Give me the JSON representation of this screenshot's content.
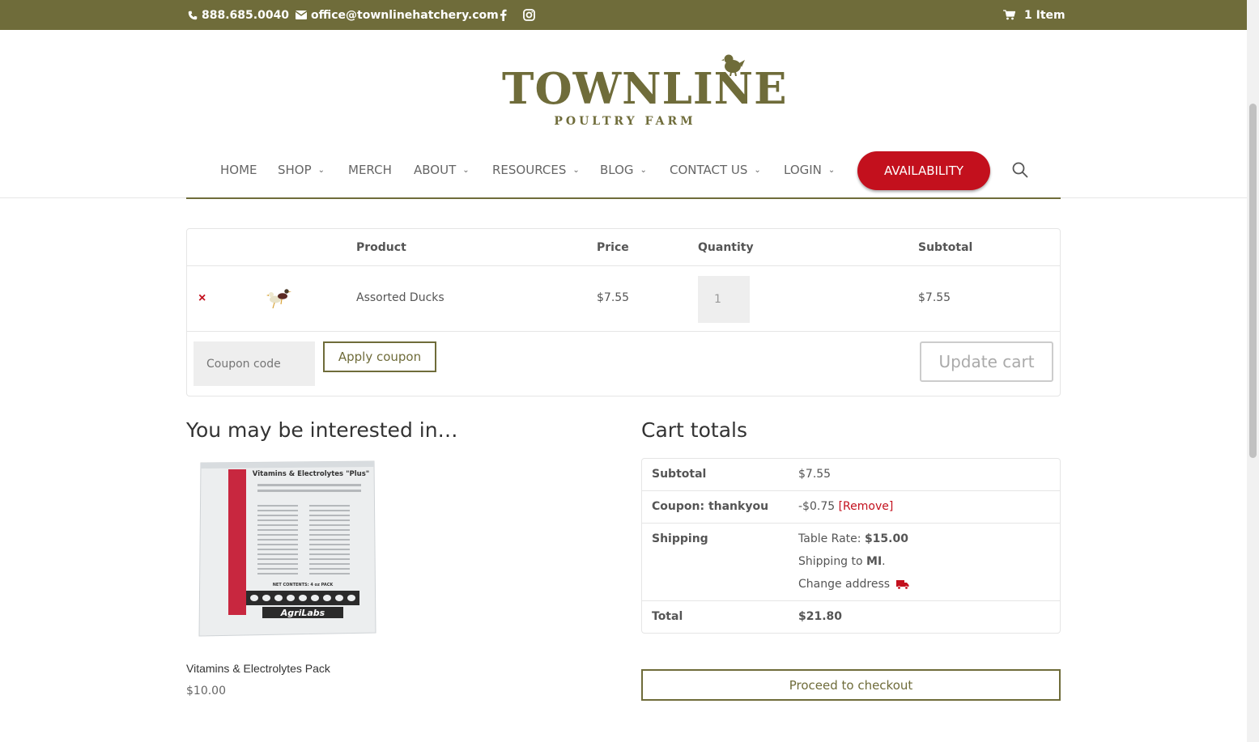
{
  "topbar": {
    "phone": "888.685.0040",
    "email": "office@townlinehatchery.com",
    "cart_count": "1 Item",
    "icons": [
      "phone-icon",
      "mail-icon",
      "facebook-icon",
      "instagram-icon",
      "cart-icon"
    ]
  },
  "logo": {
    "main": "TOWNLINE",
    "sub": "POULTRY FARM"
  },
  "nav": {
    "items": [
      {
        "label": "HOME",
        "has_dropdown": false
      },
      {
        "label": "SHOP",
        "has_dropdown": true
      },
      {
        "label": "MERCH",
        "has_dropdown": false
      },
      {
        "label": "ABOUT",
        "has_dropdown": true
      },
      {
        "label": "RESOURCES",
        "has_dropdown": true
      },
      {
        "label": "BLOG",
        "has_dropdown": true
      },
      {
        "label": "CONTACT US",
        "has_dropdown": true
      },
      {
        "label": "LOGIN",
        "has_dropdown": true
      }
    ],
    "cta": "AVAILABILITY"
  },
  "cart": {
    "headers": {
      "product": "Product",
      "price": "Price",
      "quantity": "Quantity",
      "subtotal": "Subtotal"
    },
    "items": [
      {
        "name": "Assorted Ducks",
        "price": "$7.55",
        "quantity": "1",
        "subtotal": "$7.55"
      }
    ],
    "coupon_placeholder": "Coupon code",
    "apply_label": "Apply coupon",
    "update_label": "Update cart"
  },
  "related": {
    "title": "You may be interested in…",
    "product_name": "Vitamins & Electrolytes Pack",
    "product_price": "$10.00",
    "pack": {
      "title": "Vitamins & Electrolytes \"Plus\"",
      "contents": "NET CONTENTS: 4 oz PACK",
      "brand": "AgriLabs"
    }
  },
  "totals": {
    "title": "Cart totals",
    "subtotal_label": "Subtotal",
    "subtotal_value": "$7.55",
    "coupon_label": "Coupon: thankyou",
    "coupon_value": "-$0.75",
    "coupon_remove": "[Remove]",
    "shipping_label": "Shipping",
    "shipping_rate_label": "Table Rate:",
    "shipping_rate_value": "$15.00",
    "shipping_to_label": "Shipping to",
    "shipping_to_value": "MI",
    "change_address": "Change address",
    "total_label": "Total",
    "total_value": "$21.80",
    "checkout_label": "Proceed to checkout"
  },
  "colors": {
    "brand_olive": "#6f6c3a",
    "accent_red": "#c3101d"
  }
}
